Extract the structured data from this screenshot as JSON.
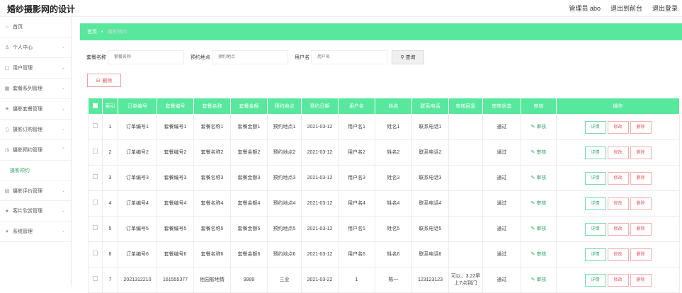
{
  "app": {
    "title": "婚纱摄影网的设计"
  },
  "header": {
    "user": "管理员 abo",
    "back": "退出到前台",
    "logout": "退出登录"
  },
  "sidebar": {
    "items": [
      {
        "label": "首页",
        "icon": "home-icon"
      },
      {
        "label": "个人中心",
        "icon": "user-icon"
      },
      {
        "label": "用户管理",
        "icon": "users-icon"
      },
      {
        "label": "套餐系列管理",
        "icon": "grid-icon"
      },
      {
        "label": "摄影套餐管理",
        "icon": "camera-icon"
      },
      {
        "label": "摄影订购管理",
        "icon": "order-icon"
      },
      {
        "label": "摄影预约管理",
        "icon": "clock-icon"
      }
    ],
    "sub": "摄影预约",
    "items2": [
      {
        "label": "摄影评价管理",
        "icon": "comment-icon"
      },
      {
        "label": "客片欣赏管理",
        "icon": "image-icon"
      },
      {
        "label": "系统管理",
        "icon": "settings-icon"
      }
    ]
  },
  "breadcrumb": {
    "home": "首页",
    "current": "摄影预约"
  },
  "search": {
    "f1_label": "套餐名称",
    "f1_placeholder": "套餐名称",
    "f2_label": "预约地点",
    "f2_placeholder": "预约地点",
    "f3_label": "用户名",
    "f3_placeholder": "用户名",
    "btn": "查询"
  },
  "delete_btn": "删除",
  "table": {
    "headers": [
      "索引",
      "订单编号",
      "套餐编号",
      "套餐名称",
      "套餐金额",
      "预约地点",
      "预约日期",
      "用户名",
      "姓名",
      "联系电话",
      "审核回复",
      "审核状态",
      "审核",
      "操作"
    ],
    "rows": [
      [
        "1",
        "订单编号1",
        "套餐编号1",
        "套餐名称1",
        "套餐金额1",
        "预约地点1",
        "2021-03-12",
        "用户名1",
        "姓名1",
        "联系电话1",
        "",
        "通过"
      ],
      [
        "2",
        "订单编号2",
        "套餐编号2",
        "套餐名称2",
        "套餐金额2",
        "预约地点2",
        "2021-03-12",
        "用户名2",
        "姓名2",
        "联系电话2",
        "",
        "通过"
      ],
      [
        "3",
        "订单编号3",
        "套餐编号3",
        "套餐名称3",
        "套餐金额3",
        "预约地点3",
        "2021-03-12",
        "用户名3",
        "姓名3",
        "联系电话3",
        "",
        "通过"
      ],
      [
        "4",
        "订单编号4",
        "套餐编号4",
        "套餐名称4",
        "套餐金额4",
        "预约地点4",
        "2021-03-12",
        "用户名4",
        "姓名4",
        "联系电话4",
        "",
        "通过"
      ],
      [
        "5",
        "订单编号5",
        "套餐编号5",
        "套餐名称5",
        "套餐金额5",
        "预约地点5",
        "2021-03-12",
        "用户名5",
        "姓名5",
        "联系电话5",
        "",
        "通过"
      ],
      [
        "6",
        "订单编号6",
        "套餐编号6",
        "套餐名称6",
        "套餐金额6",
        "预约地点6",
        "2021-03-12",
        "用户名6",
        "姓名6",
        "联系电话6",
        "",
        "通过"
      ],
      [
        "7",
        "2021312210",
        "161555377",
        "他园般地情",
        "9999",
        "三业",
        "2021-03-22",
        "1",
        "陈一",
        "123123123",
        "可以，3.22早上7点到门",
        "通过"
      ]
    ],
    "audit_label": "审核",
    "op_detail": "详情",
    "op_edit": "修改",
    "op_delete": "删除"
  }
}
